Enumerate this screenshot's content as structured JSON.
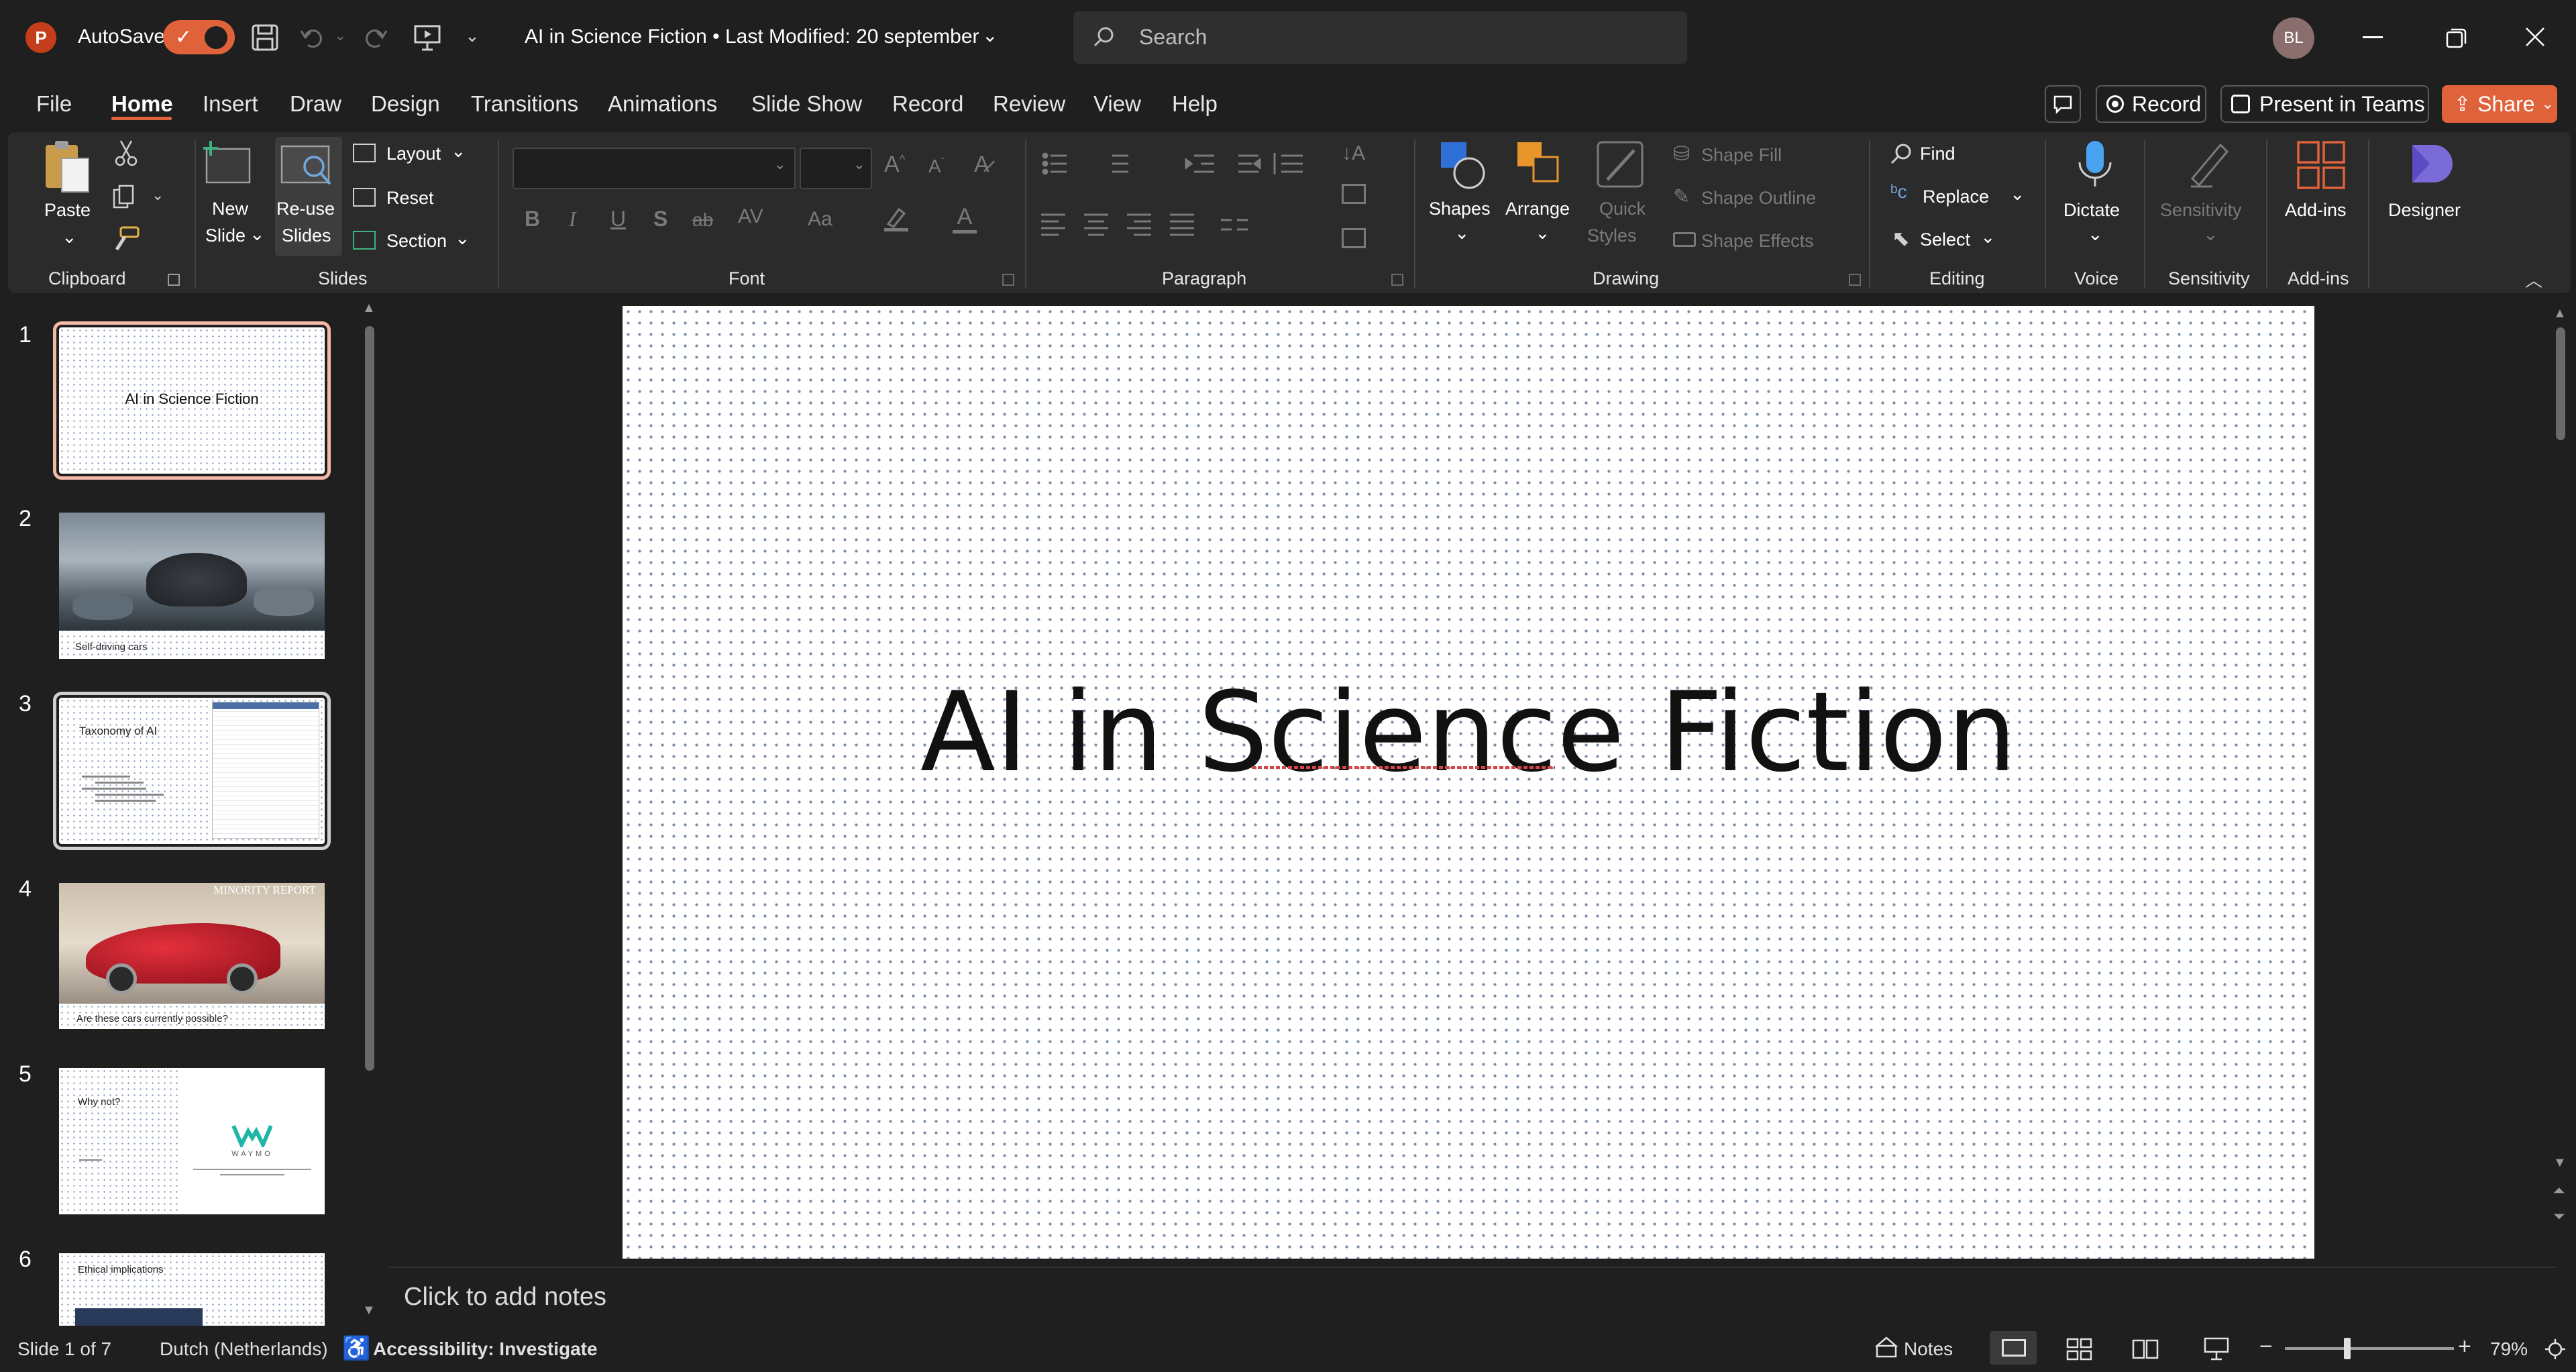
{
  "app": {
    "name": "PowerPoint",
    "logo_letter": "P"
  },
  "titlebar": {
    "autosave_label": "AutoSave",
    "doc_title": "AI in Science Fiction • Last Modified: 20 september",
    "search_placeholder": "Search",
    "user_initials": "BL"
  },
  "tabs": [
    "File",
    "Home",
    "Insert",
    "Draw",
    "Design",
    "Transitions",
    "Animations",
    "Slide Show",
    "Record",
    "Review",
    "View",
    "Help"
  ],
  "active_tab": "Home",
  "top_buttons": {
    "record": "Record",
    "present": "Present in Teams",
    "share": "Share"
  },
  "ribbon": {
    "clipboard": {
      "paste": "Paste",
      "group": "Clipboard"
    },
    "slides": {
      "new_slide_1": "New",
      "new_slide_2": "Slide",
      "reuse_1": "Re-use",
      "reuse_2": "Slides",
      "layout": "Layout",
      "reset": "Reset",
      "section": "Section",
      "group": "Slides"
    },
    "font": {
      "group": "Font",
      "bold": "B",
      "italic": "I",
      "underline": "U",
      "shadow": "S",
      "strike": "ab",
      "spacing": "AV",
      "case": "Aa"
    },
    "paragraph": {
      "group": "Paragraph"
    },
    "drawing": {
      "shapes": "Shapes",
      "arrange": "Arrange",
      "quick_styles_1": "Quick",
      "quick_styles_2": "Styles",
      "shape_fill": "Shape Fill",
      "shape_outline": "Shape Outline",
      "shape_effects": "Shape Effects",
      "group": "Drawing"
    },
    "editing": {
      "find": "Find",
      "replace": "Replace",
      "select": "Select",
      "group": "Editing"
    },
    "voice": {
      "dictate": "Dictate",
      "group": "Voice"
    },
    "sensitivity": {
      "label": "Sensitivity",
      "group": "Sensitivity"
    },
    "addins": {
      "label": "Add-ins",
      "group": "Add-ins"
    },
    "designer": {
      "label": "Designer"
    }
  },
  "slides": [
    {
      "num": "1",
      "caption": "AI in Science Fiction"
    },
    {
      "num": "2",
      "caption": "Self-driving cars"
    },
    {
      "num": "3",
      "caption": "Taxonomy of AI"
    },
    {
      "num": "4",
      "caption": "Are these cars currently possible?",
      "overlay": "MINORITY REPORT"
    },
    {
      "num": "5",
      "caption": "Why not?",
      "logo": "WAYMO"
    },
    {
      "num": "6",
      "caption": "Ethical implications"
    }
  ],
  "slide_title": "AI in Science Fiction",
  "notes_placeholder": "Click to add notes",
  "status": {
    "slide_of": "Slide 1 of 7",
    "language": "Dutch (Netherlands)",
    "accessibility": "Accessibility: Investigate",
    "notes": "Notes",
    "zoom": "79%"
  },
  "colors": {
    "accent": "#e0623b",
    "background": "#1f1f1f",
    "ribbon": "#2b2b2b",
    "slide": "#ffffff"
  }
}
